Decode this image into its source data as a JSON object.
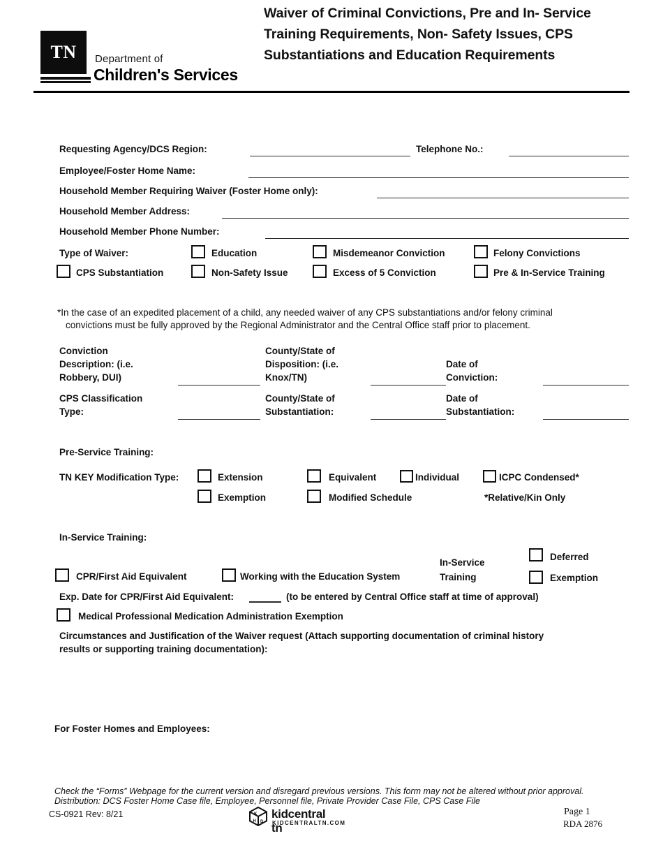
{
  "header": {
    "logo": {
      "badge_text": "TN",
      "dept_line1": "Department of",
      "dept_line2": "Children's Services"
    },
    "title": "Waiver of Criminal Convictions, Pre and In- Service Training Requirements, Non- Safety Issues, CPS Substantiations and Education Requirements"
  },
  "fields": {
    "requesting_agency": {
      "label": "Requesting Agency/DCS Region:",
      "value": ""
    },
    "telephone": {
      "label": "Telephone No.:",
      "value": ""
    },
    "employee_foster_home_name": {
      "label": "Employee/Foster Home Name:",
      "value": ""
    },
    "household_member_requiring_waiver": {
      "label": "Household Member Requiring Waiver (Foster Home only):",
      "value": ""
    },
    "household_member_address": {
      "label": "Household Member Address:",
      "value": ""
    },
    "household_member_phone": {
      "label": "Household Member Phone Number:",
      "value": ""
    }
  },
  "type_of_waiver": {
    "label": "Type of Waiver:",
    "options": [
      {
        "label": "Education",
        "checked": false
      },
      {
        "label": "Misdemeanor Conviction",
        "checked": false
      },
      {
        "label": "Felony Convictions",
        "checked": false
      },
      {
        "label": "CPS Substantiation",
        "checked": false
      },
      {
        "label": "Non-Safety Issue",
        "checked": false
      },
      {
        "label": "Excess of 5 Conviction",
        "checked": false
      },
      {
        "label": "Pre & In-Service Training",
        "checked": false
      }
    ]
  },
  "note": {
    "line1": "*In the case of an expedited placement of a child, any needed waiver of any CPS substantiations and/or felony criminal",
    "line2": "convictions must be fully approved by the Regional Administrator and the Central Office staff prior to placement."
  },
  "conviction_block": {
    "conviction_description_label": "Conviction Description: (i.e. Robbery, DUI)",
    "conviction_description_l1": "Conviction",
    "conviction_description_l2": "Description: (i.e.",
    "conviction_description_l3": "Robbery, DUI)",
    "conviction_description_value": "",
    "county_disposition_l1": "County/State of",
    "county_disposition_l2": "Disposition: (i.e.",
    "county_disposition_l3": "Knox/TN)",
    "county_disposition_value": "",
    "date_conviction_l1": "Date of",
    "date_conviction_l2": "Conviction:",
    "date_conviction_value": "",
    "cps_classification_l1": "CPS Classification",
    "cps_classification_l2": "Type:",
    "cps_classification_value": "",
    "county_substantiation_l1": "County/State of",
    "county_substantiation_l2": "Substantiation:",
    "county_substantiation_value": "",
    "date_substantiation_l1": "Date of",
    "date_substantiation_l2": "Substantiation:",
    "date_substantiation_value": ""
  },
  "pre_service": {
    "heading": "Pre-Service Training:",
    "modification_label": "TN KEY Modification Type:",
    "options_row1": [
      {
        "label": "Extension",
        "checked": false
      },
      {
        "label": "Equivalent",
        "checked": false
      },
      {
        "label": "Individual",
        "checked": false
      },
      {
        "label": "ICPC Condensed*",
        "checked": false
      }
    ],
    "options_row2": [
      {
        "label": "Exemption",
        "checked": false
      },
      {
        "label": "Modified Schedule",
        "checked": false
      }
    ],
    "footnote": "*Relative/Kin Only"
  },
  "in_service": {
    "heading": "In-Service Training:",
    "cpr_first_aid": {
      "label": "CPR/First Aid Equivalent",
      "checked": false
    },
    "working_education": {
      "label": "Working with the Education System",
      "checked": false
    },
    "in_service_training_l1": "In-Service",
    "in_service_training_l2": "Training",
    "deferred": {
      "label": "Deferred",
      "checked": false
    },
    "exemption": {
      "label": "Exemption",
      "checked": false
    },
    "exp_date_prefix": "Exp. Date for CPR/First Aid Equivalent:",
    "exp_date_value": "",
    "exp_date_suffix": "(to be entered by Central Office staff at time of approval)",
    "medical_exemption": {
      "label": "Medical Professional Medication Administration Exemption",
      "checked": false
    }
  },
  "circumstances": {
    "line1": "Circumstances and Justification of the Waiver request (Attach supporting documentation of criminal history",
    "line2": "results or supporting training documentation):",
    "value": ""
  },
  "for_foster_homes": "For Foster Homes and Employees:",
  "footer": {
    "notice_line1": "Check the “Forms” Webpage for the current version and disregard previous versions. This form may not be altered without prior approval.",
    "notice_line2": "Distribution:  DCS Foster Home Case file, Employee, Personnel file, Private Provider Case File, CPS Case File",
    "form_id": "CS-0921  Rev:  8/21",
    "kidcentral_name": "kidcentral tn",
    "kidcentral_sub": "KIDCENTRALTN.COM",
    "page": "Page 1",
    "rda": "RDA 2876"
  }
}
